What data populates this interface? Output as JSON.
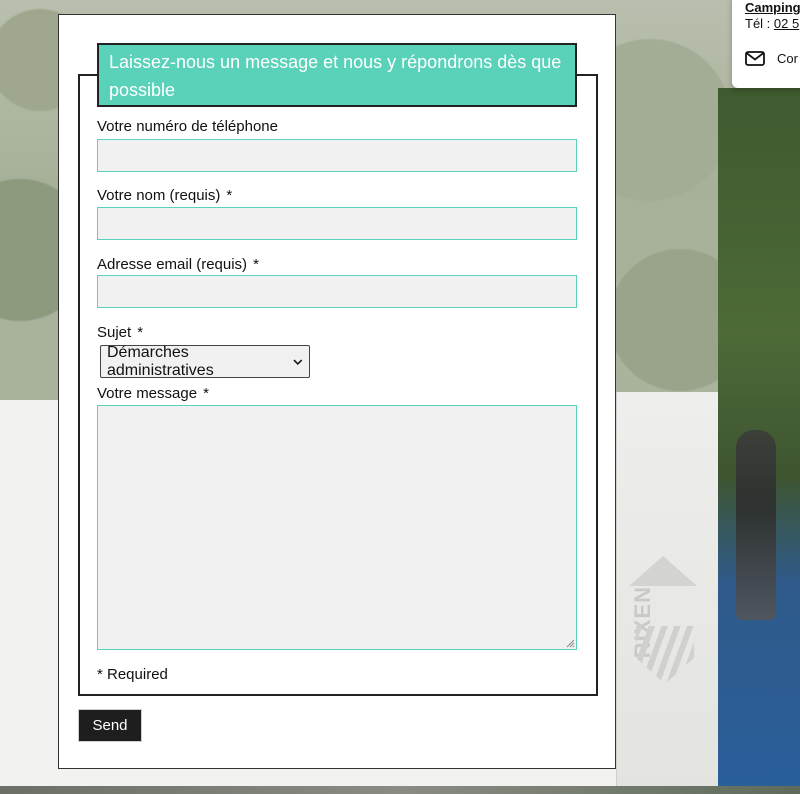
{
  "info_card": {
    "camping_label": "Camping",
    "tel_prefix": "Tél : ",
    "tel_number": "02 5",
    "contact_label": "Cor"
  },
  "form": {
    "legend": "Laissez-nous un message et nous y répondrons dès que possible",
    "phone_label": "Votre numéro de téléphone",
    "name_label": "Votre nom (requis)",
    "email_label": "Adresse email (requis)",
    "subject_label": "Sujet",
    "subject_selected": "Démarches administratives",
    "message_label": "Votre message",
    "required_star": "*",
    "required_note": "* Required",
    "send_label": "Send"
  },
  "background": {
    "logo_text": "RIXEN"
  },
  "colors": {
    "accent": "#5ad1b9",
    "field_bg": "#f1f1f1",
    "button_bg": "#1e1e1e"
  }
}
